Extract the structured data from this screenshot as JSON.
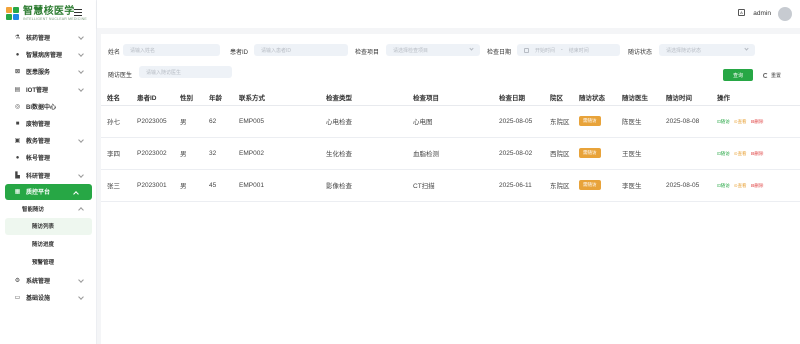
{
  "brand": {
    "title": "智慧核医学",
    "subtitle": "INTELLIGENT NUCLEAR MEDICINE"
  },
  "header": {
    "username": "admin",
    "screen_icon": "fullscreen-icon"
  },
  "sidebar": {
    "items": [
      {
        "label": "核药管理",
        "icon": "flask-icon"
      },
      {
        "label": "智慧病房管理",
        "icon": "bed-icon"
      },
      {
        "label": "医患服务",
        "icon": "service-icon"
      },
      {
        "label": "IOT管理",
        "icon": "iot-icon"
      },
      {
        "label": "BI数据中心",
        "icon": "chart-icon"
      },
      {
        "label": "废物管理",
        "icon": "box-icon"
      },
      {
        "label": "教务管理",
        "icon": "book-icon"
      },
      {
        "label": "帐号管理",
        "icon": "user-icon"
      },
      {
        "label": "科研管理",
        "icon": "research-icon"
      },
      {
        "label": "质控平台",
        "icon": "qc-icon"
      }
    ],
    "sub_group": "智能随访",
    "sub_items": [
      "随访列表",
      "随访进度",
      "预警管理"
    ],
    "bottom_items": [
      {
        "label": "系统管理",
        "icon": "gear-icon"
      },
      {
        "label": "基础设施",
        "icon": "monitor-icon"
      }
    ]
  },
  "filters": {
    "name_label": "姓名",
    "name_ph": "请输入姓名",
    "pid_label": "患者ID",
    "pid_ph": "请输入患者ID",
    "exam_label": "检查项目",
    "exam_ph": "请选择检查项目",
    "date_label": "检查日期",
    "date_start_ph": "开始时间",
    "date_sep": "-",
    "date_end_ph": "结束时间",
    "status_label": "随访状态",
    "status_ph": "请选择随访状态",
    "doctor_label": "随访医生",
    "doctor_ph": "请输入随访医生",
    "query_btn": "查询",
    "reset_btn": "重置"
  },
  "table": {
    "headers": [
      "姓名",
      "患者ID",
      "性别",
      "年龄",
      "联系方式",
      "检查类型",
      "检查项目",
      "检查日期",
      "院区",
      "随访状态",
      "随访医生",
      "随访时间",
      "操作"
    ],
    "rows": [
      {
        "name": "孙七",
        "pid": "P2023005",
        "gender": "男",
        "age": "62",
        "contact": "EMP005",
        "type": "心电检查",
        "item": "心电图",
        "date": "2025-08-05",
        "campus": "东院区",
        "status": "需随访",
        "doctor": "陈医生",
        "time": "2025-08-08"
      },
      {
        "name": "李四",
        "pid": "P2023002",
        "gender": "男",
        "age": "32",
        "contact": "EMP002",
        "type": "生化检查",
        "item": "血脂检测",
        "date": "2025-08-02",
        "campus": "西院区",
        "status": "需随访",
        "doctor": "王医生",
        "time": ""
      },
      {
        "name": "张三",
        "pid": "P2023001",
        "gender": "男",
        "age": "45",
        "contact": "EMP001",
        "type": "影像检查",
        "item": "CT扫描",
        "date": "2025-06-11",
        "campus": "东院区",
        "status": "需随访",
        "doctor": "李医生",
        "time": "2025-08-05"
      }
    ],
    "actions": {
      "followup": "随访",
      "view": "查看",
      "delete": "删除"
    }
  },
  "colors": {
    "accent": "#27a745",
    "badge": "#e8a33a",
    "danger": "#e04848"
  }
}
